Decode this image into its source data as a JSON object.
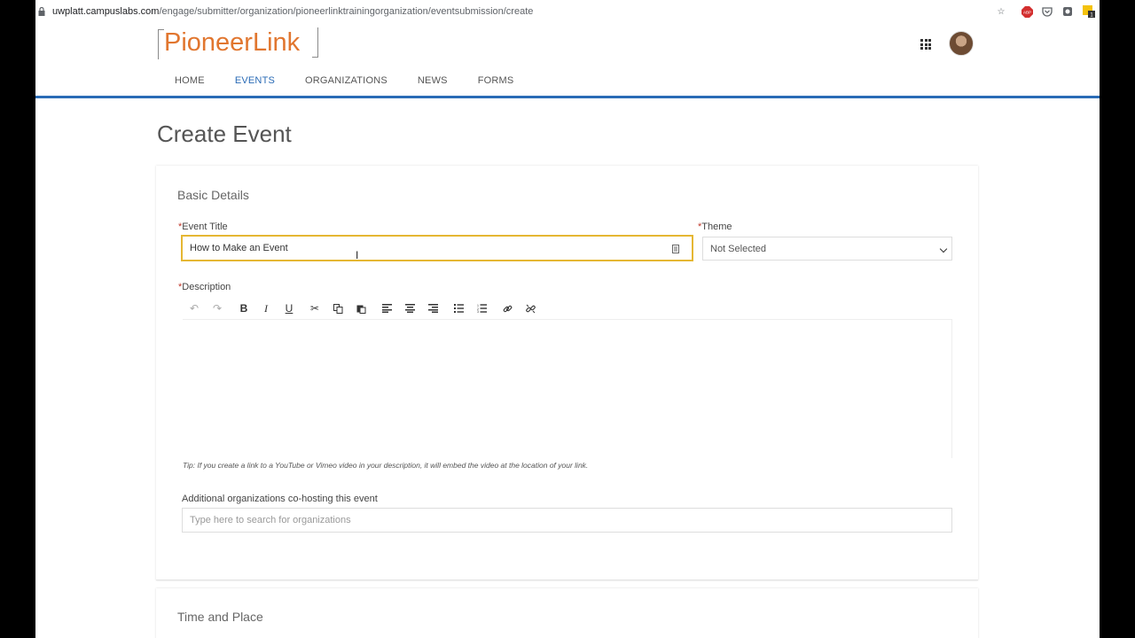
{
  "browser": {
    "url_host": "uwplatt.campuslabs.com",
    "url_path": "/engage/submitter/organization/pioneerlinktrainingorganization/eventsubmission/create"
  },
  "header": {
    "logo_text": "PioneerLink",
    "nav": [
      {
        "label": "HOME"
      },
      {
        "label": "EVENTS"
      },
      {
        "label": "ORGANIZATIONS"
      },
      {
        "label": "NEWS"
      },
      {
        "label": "FORMS"
      }
    ],
    "active_nav": "EVENTS"
  },
  "page": {
    "title": "Create Event"
  },
  "basic_details": {
    "section_title": "Basic Details",
    "event_title_label": "Event Title",
    "event_title_value": "How to Make an Event",
    "theme_label": "Theme",
    "theme_value": "Not Selected",
    "description_label": "Description",
    "tip": "Tip: If you create a link to a YouTube or Vimeo video in your description, it will embed the video at the location of your link.",
    "cohost_label": "Additional organizations co-hosting this event",
    "cohost_placeholder": "Type here to search for organizations",
    "required_marker": "*"
  },
  "time_place": {
    "section_title": "Time and Place"
  },
  "colors": {
    "accent_blue": "#2a6bb6",
    "logo_orange": "#e1762f",
    "focus_yellow": "#e5b733",
    "required_red": "#c0392b"
  },
  "toolbar_icons": [
    "undo-icon",
    "redo-icon",
    "bold-icon",
    "italic-icon",
    "underline-icon",
    "cut-icon",
    "copy-icon",
    "paste-icon",
    "align-left-icon",
    "align-center-icon",
    "align-right-icon",
    "bullet-list-icon",
    "numbered-list-icon",
    "link-icon",
    "unlink-icon"
  ]
}
